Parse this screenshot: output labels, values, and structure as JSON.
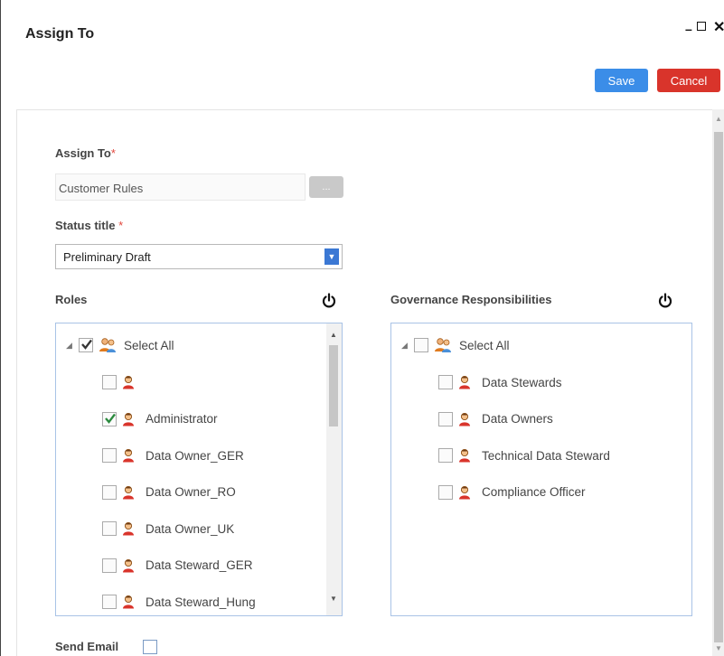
{
  "window": {
    "title": "Assign To",
    "minimize_glyph": "–",
    "close_glyph": "✕"
  },
  "toolbar": {
    "save_label": "Save",
    "cancel_label": "Cancel"
  },
  "form": {
    "assign_to_label": "Assign To",
    "assign_to_value": "Customer Rules",
    "ellipsis_label": "...",
    "status_title_label": "Status title",
    "status_title_value": "Preliminary Draft",
    "required_mark": "*",
    "send_email_label": "Send Email",
    "send_email_checked": false
  },
  "roles": {
    "header": "Roles",
    "select_all_label": "Select All",
    "select_all_checked": true,
    "items": [
      {
        "label": "",
        "checked": false
      },
      {
        "label": "Administrator",
        "checked": true
      },
      {
        "label": "Data Owner_GER",
        "checked": false
      },
      {
        "label": "Data Owner_RO",
        "checked": false
      },
      {
        "label": "Data Owner_UK",
        "checked": false
      },
      {
        "label": "Data Steward_GER",
        "checked": false
      },
      {
        "label": "Data Steward_Hung",
        "checked": false
      }
    ]
  },
  "governance": {
    "header": "Governance Responsibilities",
    "select_all_label": "Select All",
    "select_all_checked": false,
    "items": [
      {
        "label": "Data Stewards",
        "checked": false
      },
      {
        "label": "Data Owners",
        "checked": false
      },
      {
        "label": "Technical Data Steward",
        "checked": false
      },
      {
        "label": "Compliance Officer",
        "checked": false
      }
    ]
  },
  "icons": {
    "power": "power-icon",
    "group": "users-group-icon",
    "user": "user-icon",
    "expand": "expand-triangle-icon"
  },
  "colors": {
    "save": "#3b8de8",
    "cancel": "#d9342b",
    "required": "#e2473d",
    "dropdown_arrow": "#3b78d4",
    "panel_border": "#a9c3e6"
  }
}
